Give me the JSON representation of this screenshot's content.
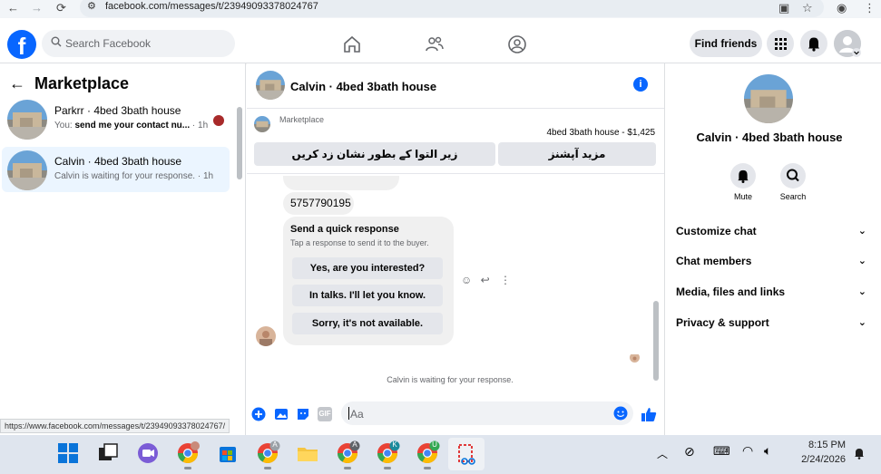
{
  "browser": {
    "url": "facebook.com/messages/t/23949093378024767",
    "back": "←",
    "forward": "→",
    "reload": "⟳"
  },
  "header": {
    "logo": "f",
    "search_placeholder": "Search Facebook",
    "find_friends": "Find friends"
  },
  "left": {
    "title": "Marketplace",
    "conversations": [
      {
        "name": "Parkrr · 4bed 3bath house",
        "preview_prefix": "You: ",
        "preview": "send me your contact nu...",
        "time": " · 1h"
      },
      {
        "name": "Calvin · 4bed 3bath house",
        "preview_prefix": "",
        "preview": "Calvin is waiting for your response.",
        "time": " · 1h"
      }
    ],
    "status_url": "https://www.facebook.com/messages/t/23949093378024767/"
  },
  "chat": {
    "title": "Calvin · 4bed 3bath house",
    "marketplace_label": "Marketplace",
    "listing": "4bed 3bath house - $1,425",
    "btn_mark": "زیر التوا کے بطور نشان زد کریں",
    "btn_more": "مزید آپشنز",
    "phone": "5757790195",
    "quick_title": "Send a quick response",
    "quick_sub": "Tap a response to send it to the buyer.",
    "quick_replies": [
      "Yes, are you interested?",
      "In talks. I'll let you know.",
      "Sorry, it's not available."
    ],
    "waiting": "Calvin is waiting for your response.",
    "input_placeholder": "Aa",
    "gif": "GIF"
  },
  "right": {
    "name": "Calvin · 4bed 3bath house",
    "mute": "Mute",
    "search": "Search",
    "rows": [
      "Customize chat",
      "Chat members",
      "Media, files and links",
      "Privacy & support"
    ]
  },
  "taskbar": {
    "time": "8:15 PM",
    "date": "2/24/2026",
    "badges": [
      "A",
      "A",
      "K",
      "U"
    ]
  },
  "colors": {
    "accent": "#0866ff",
    "bubble": "#f0f0f0",
    "button": "#e4e6eb"
  }
}
